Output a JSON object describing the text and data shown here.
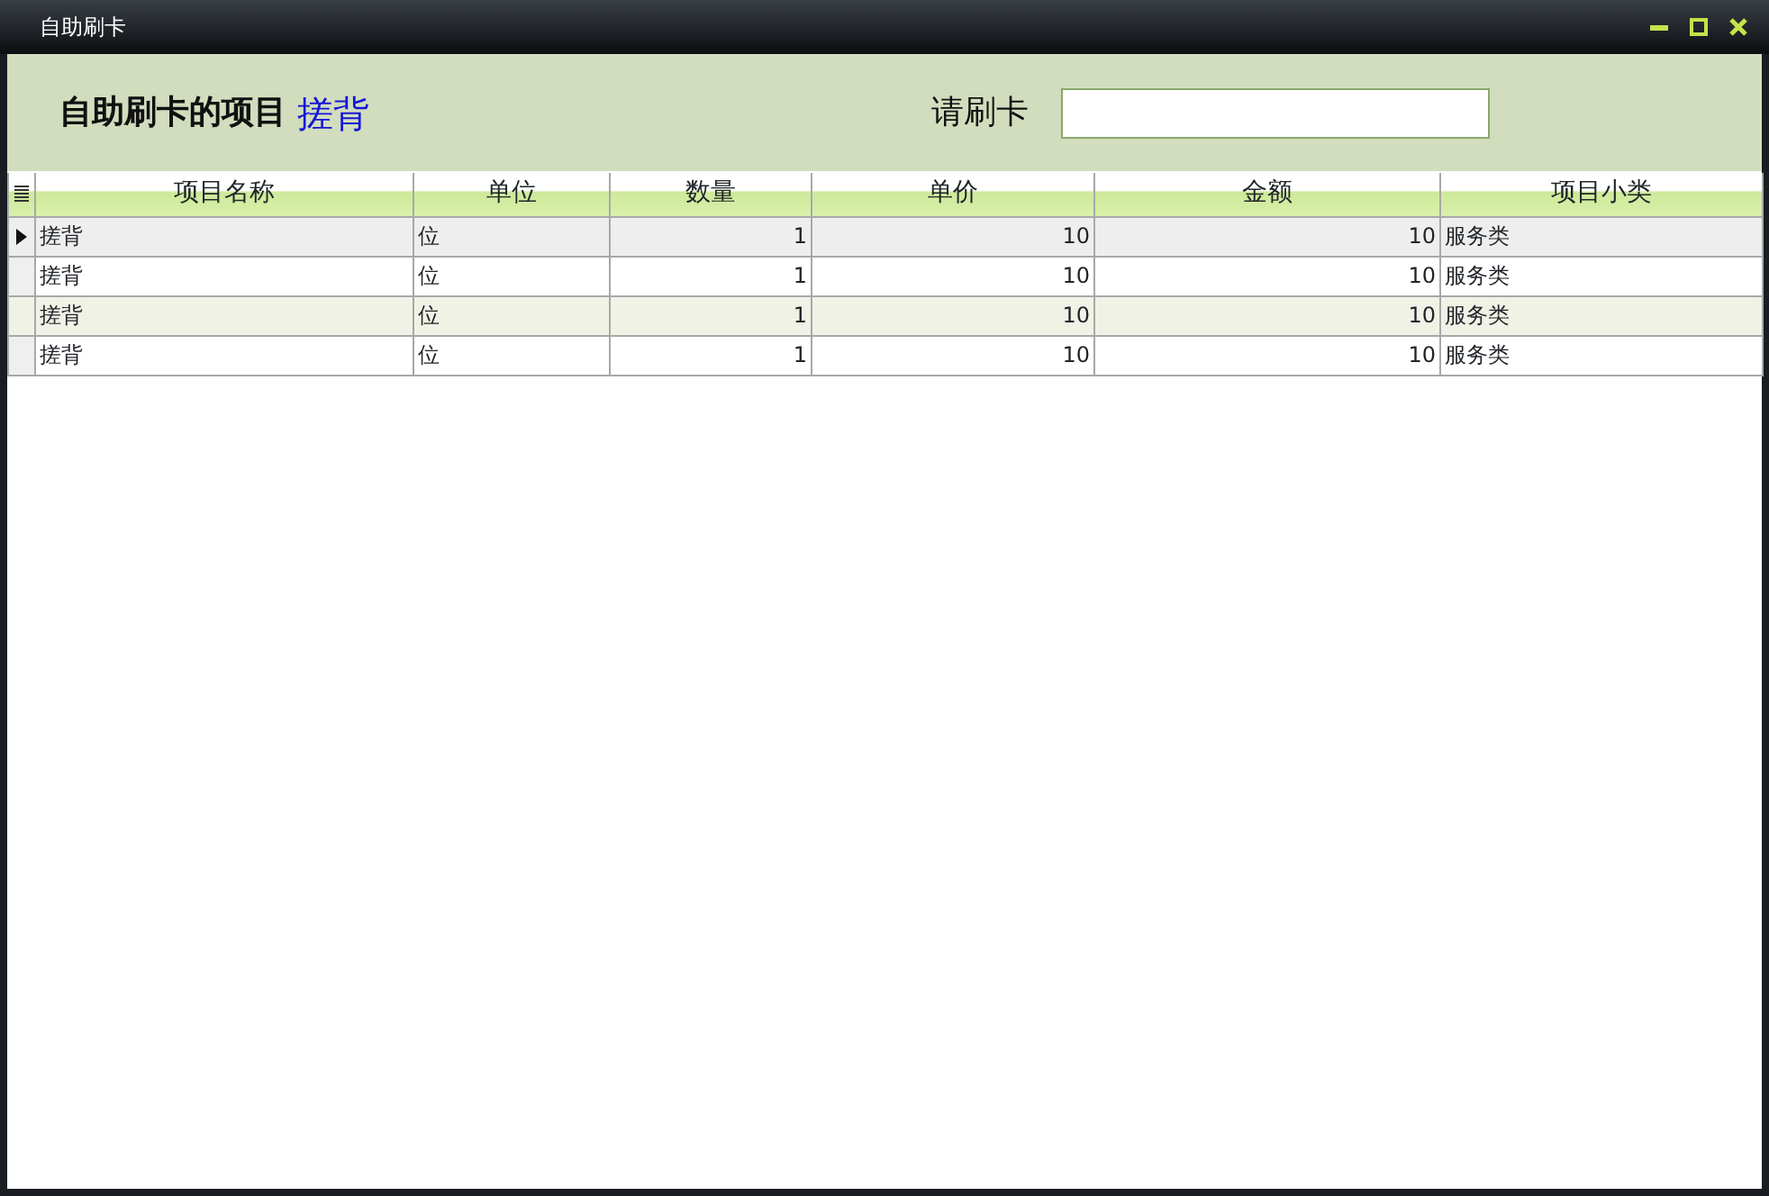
{
  "window": {
    "title": "自助刷卡"
  },
  "header": {
    "heading": "自助刷卡的项目",
    "item": "搓背",
    "card_label": "请刷卡"
  },
  "table": {
    "columns": [
      {
        "label": "项目名称",
        "kind": "text"
      },
      {
        "label": "单位",
        "kind": "text"
      },
      {
        "label": "数量",
        "kind": "number"
      },
      {
        "label": "单价",
        "kind": "number"
      },
      {
        "label": "金额",
        "kind": "number"
      },
      {
        "label": "项目小类",
        "kind": "text"
      }
    ],
    "rows": [
      {
        "selected": true,
        "cells": [
          "搓背",
          "位",
          "1",
          "10",
          "10",
          "服务类"
        ]
      },
      {
        "selected": false,
        "cells": [
          "搓背",
          "位",
          "1",
          "10",
          "10",
          "服务类"
        ]
      },
      {
        "selected": false,
        "cells": [
          "搓背",
          "位",
          "1",
          "10",
          "10",
          "服务类"
        ]
      },
      {
        "selected": false,
        "cells": [
          "搓背",
          "位",
          "1",
          "10",
          "10",
          "服务类"
        ]
      }
    ]
  }
}
